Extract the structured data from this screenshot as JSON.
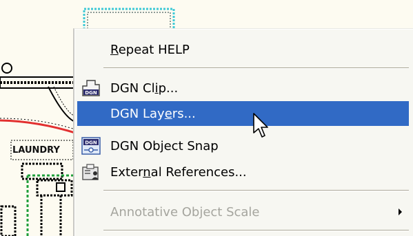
{
  "context_menu": {
    "items": [
      {
        "label_pre": "",
        "mnemonic": "R",
        "label_post": "epeat HELP",
        "icon": "none",
        "state": "normal"
      },
      {
        "label_pre": "DGN Cl",
        "mnemonic": "i",
        "label_post": "p...",
        "icon": "dgn-clip-icon",
        "state": "normal"
      },
      {
        "label_pre": "DGN Lay",
        "mnemonic": "e",
        "label_post": "rs...",
        "icon": "none",
        "state": "highlighted"
      },
      {
        "label_pre": "DGN Ob",
        "mnemonic": "j",
        "label_post": "ect Snap",
        "icon": "dgn-object-snap-icon",
        "state": "normal"
      },
      {
        "label_pre": "Exter",
        "mnemonic": "n",
        "label_post": "al References...",
        "icon": "external-references-icon",
        "state": "normal"
      },
      {
        "label_pre": "Annotative Object Scale",
        "mnemonic": "",
        "label_post": "",
        "icon": "none",
        "state": "disabled",
        "has_submenu": true
      }
    ],
    "icon_text": "DGN"
  },
  "drawing_labels": {
    "laundry": "LAUNDRY"
  },
  "colors": {
    "highlight": "#316ac5",
    "menu_background": "#f7f7f2",
    "disabled_text": "#a5a59e",
    "canvas_background": "#fdfbf1"
  }
}
